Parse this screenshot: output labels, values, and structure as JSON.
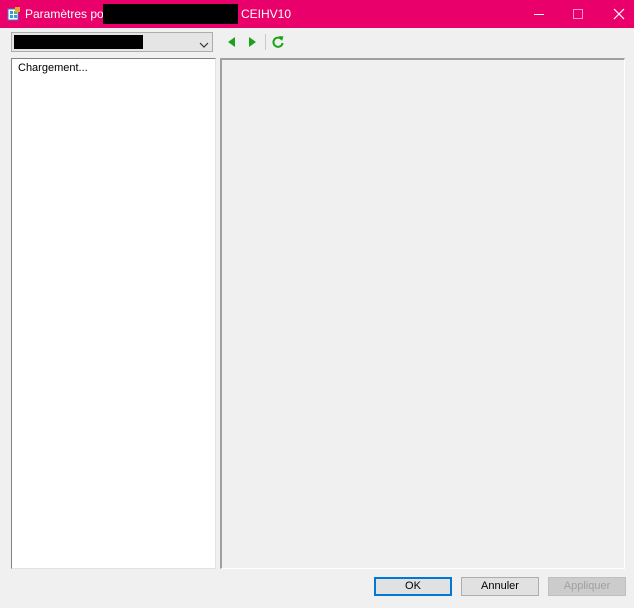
{
  "window": {
    "title_prefix": "Paramètres pour",
    "title_suffix": "CEIHV10",
    "title_bar_color": "#e9006a",
    "icons": [
      "settings-app-icon",
      "minimize-icon",
      "maximize-icon",
      "close-icon"
    ]
  },
  "toolbar": {
    "buttons": [
      "back-arrow-icon",
      "forward-arrow-icon",
      "refresh-icon"
    ],
    "accent_color": "#1aa31a"
  },
  "tree": {
    "loading_text": "Chargement..."
  },
  "footer": {
    "ok_label": "OK",
    "cancel_label": "Annuler",
    "apply_label": "Appliquer"
  }
}
